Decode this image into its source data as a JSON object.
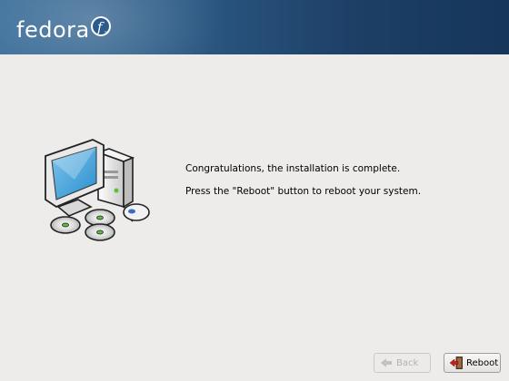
{
  "banner": {
    "logo_text": "fedora",
    "logo_tm": "™"
  },
  "message": {
    "line1": "Congratulations, the installation is complete.",
    "line2": "Press the \"Reboot\" button to reboot your system."
  },
  "buttons": {
    "back_label": "Back",
    "reboot_label": "Reboot",
    "back_enabled": false,
    "back_icon": "arrow-left-icon",
    "reboot_icon": "reboot-door-arrow-icon"
  },
  "colors": {
    "banner_start": "#3b6e9a",
    "banner_end": "#16365a",
    "background": "#edeceb",
    "reboot_icon_arrow": "#cc1f1f"
  }
}
